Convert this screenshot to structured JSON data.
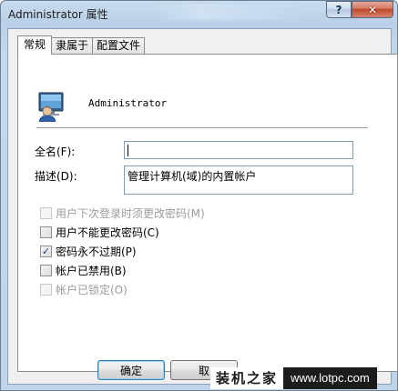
{
  "window": {
    "title": "Administrator 属性",
    "help_label": "?",
    "close_label": "✕"
  },
  "tabs": [
    {
      "label": "常规",
      "active": true
    },
    {
      "label": "隶属于",
      "active": false
    },
    {
      "label": "配置文件",
      "active": false
    }
  ],
  "user": {
    "icon": "user-icon",
    "name": "Administrator"
  },
  "fields": {
    "fullname_label": "全名(F):",
    "fullname_value": "",
    "description_label": "描述(D):",
    "description_value": "管理计算机(域)的内置帐户"
  },
  "checkboxes": [
    {
      "label": "用户下次登录时须更改密码(M)",
      "checked": false,
      "enabled": false
    },
    {
      "label": "用户不能更改密码(C)",
      "checked": false,
      "enabled": true
    },
    {
      "label": "密码永不过期(P)",
      "checked": true,
      "enabled": true
    },
    {
      "label": "帐户已禁用(B)",
      "checked": false,
      "enabled": true
    },
    {
      "label": "帐户已锁定(O)",
      "checked": false,
      "enabled": false
    }
  ],
  "buttons": {
    "ok": "确定",
    "cancel": "取"
  },
  "watermark": {
    "brand": "装机之家",
    "url": "www.lotpc.com"
  },
  "colors": {
    "titlebar": "#bfd3ea",
    "close_button": "#c0462a",
    "checkmark": "#1b3d72"
  }
}
